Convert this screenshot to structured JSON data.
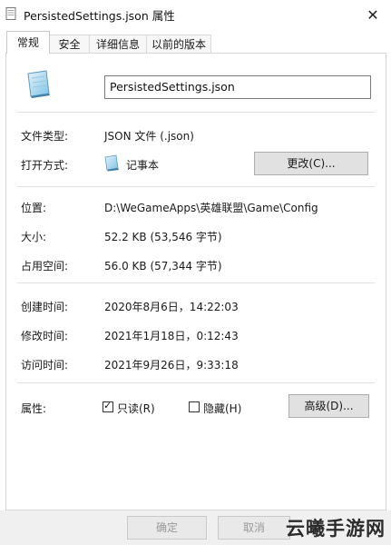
{
  "window": {
    "title": "PersistedSettings.json 属性",
    "close_symbol": "✕"
  },
  "tabs": [
    {
      "label": "常规",
      "active": true
    },
    {
      "label": "安全",
      "active": false
    },
    {
      "label": "详细信息",
      "active": false
    },
    {
      "label": "以前的版本",
      "active": false
    }
  ],
  "general": {
    "file_name": "PersistedSettings.json",
    "type_label": "文件类型:",
    "type_value": "JSON 文件 (.json)",
    "open_with_label": "打开方式:",
    "open_with_value": "记事本",
    "change_button": "更改(C)...",
    "location_label": "位置:",
    "location_value": "D:\\WeGameApps\\英雄联盟\\Game\\Config",
    "size_label": "大小:",
    "size_value": "52.2 KB (53,546 字节)",
    "size_on_disk_label": "占用空间:",
    "size_on_disk_value": "56.0 KB (57,344 字节)",
    "created_label": "创建时间:",
    "created_value": "2020年8月6日，14:22:03",
    "modified_label": "修改时间:",
    "modified_value": "2021年1月18日，0:12:43",
    "accessed_label": "访问时间:",
    "accessed_value": "2021年9月26日，9:33:18",
    "attributes_label": "属性:",
    "readonly_label": "只读(R)",
    "readonly_checked": true,
    "hidden_label": "隐藏(H)",
    "hidden_checked": false,
    "advanced_button": "高级(D)..."
  },
  "footer": {
    "ok_button": "确定",
    "cancel_button": "取消"
  },
  "watermark": "云曦手游网",
  "icons": {
    "file": "notepad-file-icon",
    "notepad": "notepad-icon",
    "check": "✓"
  }
}
